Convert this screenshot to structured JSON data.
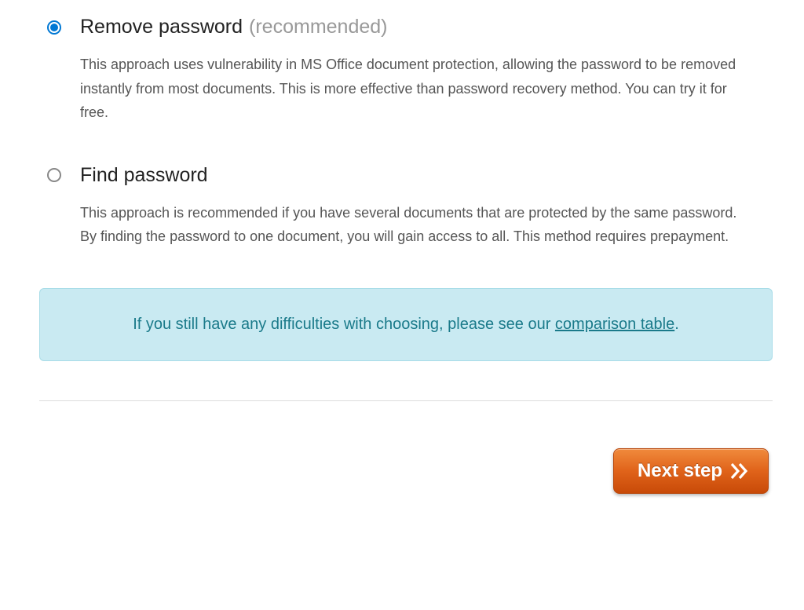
{
  "options": {
    "remove": {
      "title": "Remove password",
      "suffix": "(recommended)",
      "description": "This approach uses vulnerability in MS Office document protection, allowing the password to be removed instantly from most documents. This is more effective than password recovery method. You can try it for free.",
      "selected": true
    },
    "find": {
      "title": "Find password",
      "description": "This approach is recommended if you have several documents that are protected by the same password. By finding the password to one document, you will gain access to all. This method requires prepayment.",
      "selected": false
    }
  },
  "info": {
    "prefix": "If you still have any difficulties with choosing, please see our ",
    "link_text": "comparison table",
    "suffix": "."
  },
  "button": {
    "label": "Next step"
  }
}
